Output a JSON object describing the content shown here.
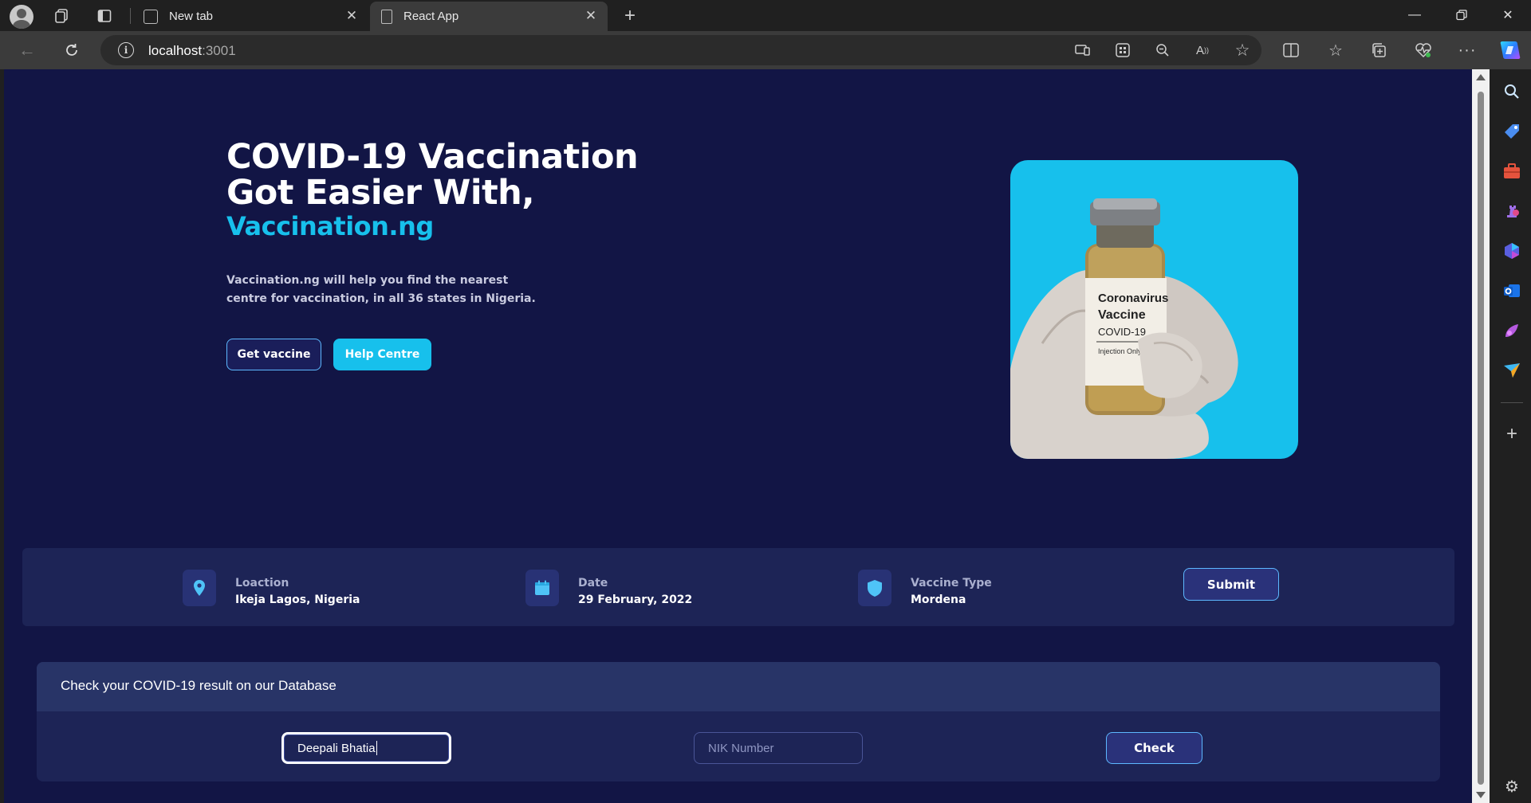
{
  "browser": {
    "tabs": [
      {
        "label": "New tab",
        "active": false
      },
      {
        "label": "React App",
        "active": true
      }
    ],
    "url_host": "localhost",
    "url_port": ":3001"
  },
  "hero": {
    "title_line1": "COVID-19 Vaccination",
    "title_line2": "Got Easier With,",
    "brand": "Vaccination.ng",
    "description_line1": "Vaccination.ng will help you find the nearest",
    "description_line2": "centre for vaccination, in all 36 states in Nigeria.",
    "primary_button": "Get vaccine",
    "secondary_button": "Help Centre",
    "image": {
      "vial_label_line1": "Coronavirus",
      "vial_label_line2": "Vaccine",
      "vial_label_line3": "COVID-19",
      "vial_label_line4": "Injection Only"
    }
  },
  "booking": {
    "location_label": "Loaction",
    "location_value": "Ikeja Lagos, Nigeria",
    "date_label": "Date",
    "date_value": "29 February, 2022",
    "vaccine_label": "Vaccine Type",
    "vaccine_value": "Mordena",
    "submit": "Submit"
  },
  "check": {
    "title": "Check your COVID-19 result on our Database",
    "name_value": "Deepali Bhatia",
    "nik_placeholder": "NIK Number",
    "button": "Check"
  },
  "colors": {
    "page_bg": "#121545",
    "accent": "#17c0ec",
    "card_bg": "#1d2456"
  }
}
